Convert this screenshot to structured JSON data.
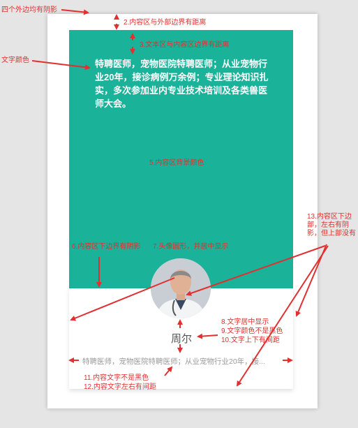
{
  "annotations": {
    "a1": "四个外边均有阴影",
    "a2": "2.内容区与外部边界有距离",
    "a3": "3.文本区与内容区边界有距离",
    "a4": "文字颜色",
    "a5": "5.内容区背景颜色",
    "a6": "6.内容区下边界有阴影",
    "a7": "7.头像圆形，并居中显示",
    "a8": "8.文字居中显示",
    "a9": "9.文字颜色不是黑色",
    "a10": "10.文字上下有间距",
    "a11": "11.内容文字不是黑色",
    "a12": "12.内容文字左右有间距",
    "a13": "13.内容区下边部，左右有阴影，但上部没有"
  },
  "card": {
    "description": "特聘医师，宠物医院特聘医师；从业宠物行业20年，接诊病例万余例；专业理论知识扎实，多次参加业内专业技术培训及各类兽医师大会。",
    "name": "周尔",
    "brief": "特聘医师，宠物医院特聘医师；从业宠物行业20年，接..."
  },
  "colors": {
    "teal": "#1bb29a",
    "annotation": "#e03030",
    "name_text": "#555555",
    "brief_text": "#9a9a9a"
  }
}
